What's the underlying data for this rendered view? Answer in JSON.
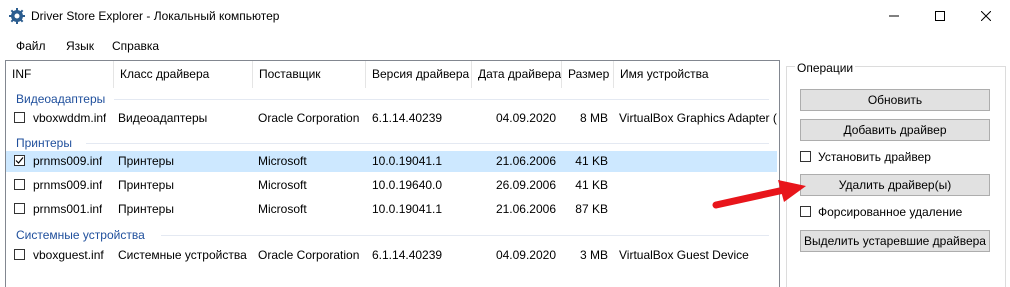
{
  "window": {
    "title": "Driver Store Explorer - Локальный компьютер",
    "minimize_glyph": "–",
    "maximize_glyph": "□",
    "close_glyph": "✕"
  },
  "menu": [
    "Файл",
    "Язык",
    "Справка"
  ],
  "columns": [
    "INF",
    "Класс драйвера",
    "Поставщик",
    "Версия драйвера",
    "Дата драйвера",
    "Размер",
    "Имя устройства"
  ],
  "groups": [
    {
      "label": "Видеоадаптеры",
      "rows": [
        {
          "inf": "vboxwddm.inf",
          "class": "Видеоадаптеры",
          "vendor": "Oracle Corporation",
          "version": "6.1.14.40239",
          "date": "04.09.2020",
          "size": "8 MB",
          "device": "VirtualBox Graphics Adapter (V",
          "checked": false,
          "selected": false
        }
      ]
    },
    {
      "label": "Принтеры",
      "rows": [
        {
          "inf": "prnms009.inf",
          "class": "Принтеры",
          "vendor": "Microsoft",
          "version": "10.0.19041.1",
          "date": "21.06.2006",
          "size": "41 KB",
          "device": "",
          "checked": true,
          "selected": true
        },
        {
          "inf": "prnms009.inf",
          "class": "Принтеры",
          "vendor": "Microsoft",
          "version": "10.0.19640.0",
          "date": "26.09.2006",
          "size": "41 KB",
          "device": "",
          "checked": false,
          "selected": false
        },
        {
          "inf": "prnms001.inf",
          "class": "Принтеры",
          "vendor": "Microsoft",
          "version": "10.0.19041.1",
          "date": "21.06.2006",
          "size": "87 KB",
          "device": "",
          "checked": false,
          "selected": false
        }
      ]
    },
    {
      "label": "Системные устройства",
      "rows": [
        {
          "inf": "vboxguest.inf",
          "class": "Системные устройства",
          "vendor": "Oracle Corporation",
          "version": "6.1.14.40239",
          "date": "04.09.2020",
          "size": "3 MB",
          "device": "VirtualBox Guest Device",
          "checked": false,
          "selected": false
        }
      ]
    }
  ],
  "operations": {
    "title": "Операции",
    "refresh": "Обновить",
    "add_driver": "Добавить драйвер",
    "install_driver": "Установить драйвер",
    "delete_driver": "Удалить драйвер(ы)",
    "force_delete": "Форсированное удаление",
    "select_old": "Выделить устаревшие драйвера"
  },
  "colors": {
    "accent_blue": "#1f4f9c",
    "selection": "#cde8ff",
    "annotation_arrow": "#e8151b"
  },
  "icons": {
    "app": "gear-icon",
    "annotation": "red-arrow-icon"
  }
}
